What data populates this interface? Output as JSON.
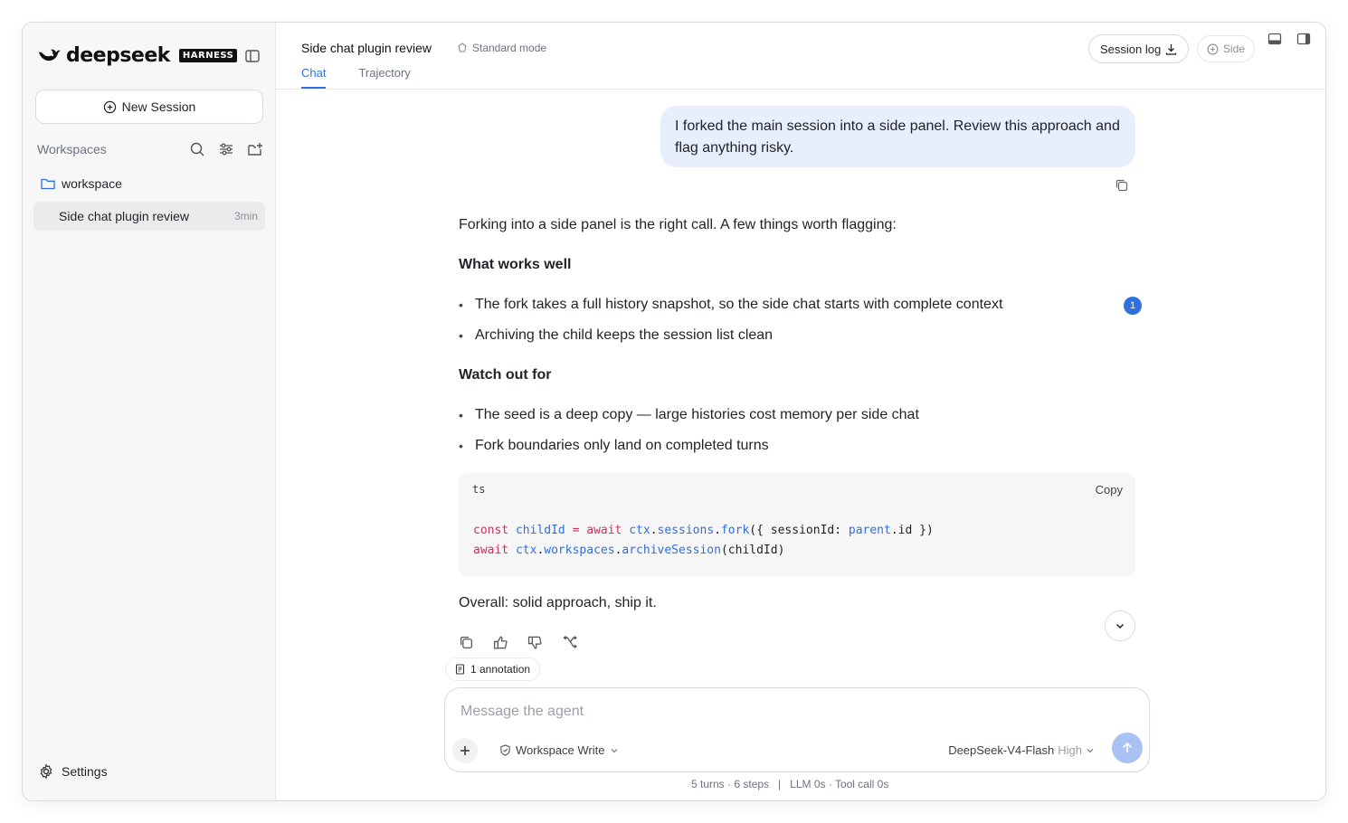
{
  "brand": {
    "name": "deepseek",
    "badge": "HARNESS"
  },
  "sidebar": {
    "new_session_label": "New Session",
    "workspaces_title": "Workspaces",
    "folder_name": "workspace",
    "sessions": [
      {
        "name": "Side chat plugin review",
        "time": "3min"
      }
    ],
    "settings_label": "Settings"
  },
  "header": {
    "session_title": "Side chat plugin review",
    "mode": "Standard mode",
    "tabs": [
      {
        "label": "Chat",
        "active": true
      },
      {
        "label": "Trajectory",
        "active": false
      }
    ],
    "session_log_label": "Session log",
    "side_label": "Side"
  },
  "chat": {
    "user_message": "I forked the main session into a side panel. Review this approach and flag anything risky.",
    "intro": "Forking into a side panel is the right call. A few things worth flagging:",
    "section1_title": "What works well",
    "section1_items": [
      "The fork takes a full history snapshot, so the side chat starts with complete context",
      "Archiving the child keeps the session list clean"
    ],
    "section2_title": "Watch out for",
    "section2_items": [
      "The seed is a deep copy — large histories cost memory per side chat",
      "Fork boundaries only land on completed turns"
    ],
    "code": {
      "lang": "ts",
      "copy_label": "Copy",
      "line1": "const childId = await ctx.sessions.fork({ sessionId: parent.id })",
      "line2": "await ctx.workspaces.archiveSession(childId)"
    },
    "closing": "Overall: solid approach, ship it.",
    "annotation_badge": "1",
    "annotation_label": "1 annotation"
  },
  "composer": {
    "placeholder": "Message the agent",
    "permission": "Workspace Write",
    "model": "DeepSeek-V4-Flash",
    "effort": "High"
  },
  "footer": {
    "stats": "5 turns · 6 steps   |   LLM 0s · Tool call 0s"
  },
  "colors": {
    "accent": "#2f6fde",
    "user_bubble": "#e8eefb",
    "send_disabled": "#a9c1f3"
  }
}
